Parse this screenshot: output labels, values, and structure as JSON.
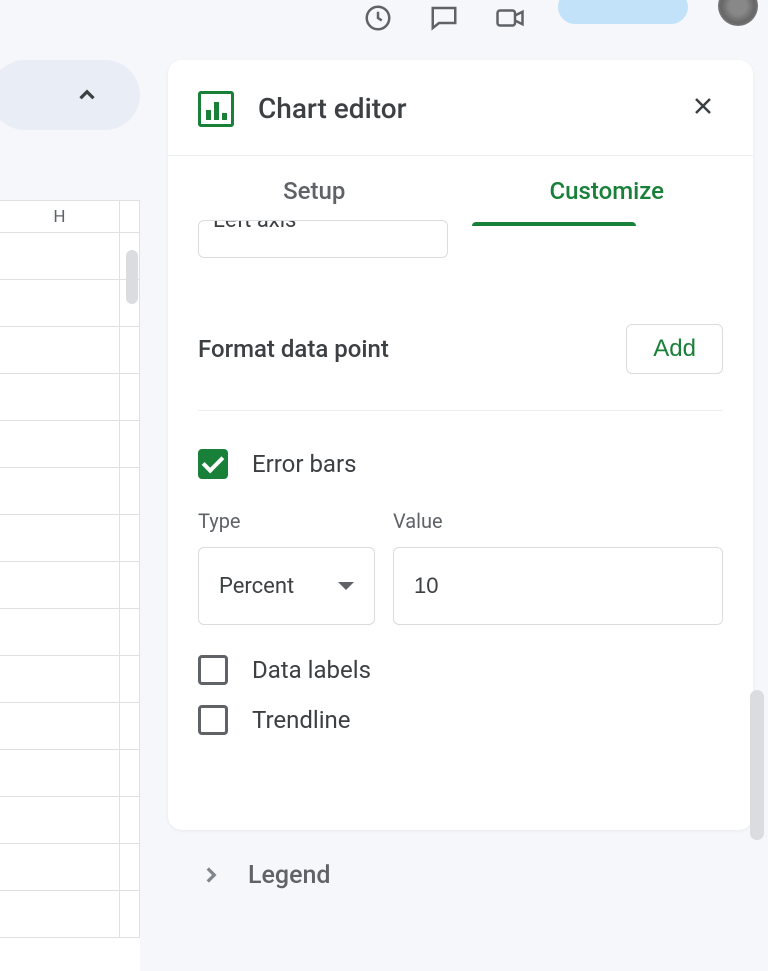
{
  "toolbar_icons": [
    "history",
    "comment",
    "video"
  ],
  "sheet": {
    "column_header": "H"
  },
  "panel": {
    "title": "Chart editor",
    "tabs": {
      "setup": "Setup",
      "customize": "Customize"
    },
    "cut_dropdown_value": "Left axis",
    "format_data_point": {
      "label": "Format data point",
      "button": "Add"
    },
    "error_bars": {
      "label": "Error bars",
      "checked": true,
      "type_label": "Type",
      "type_value": "Percent",
      "value_label": "Value",
      "value_value": "10"
    },
    "data_labels": {
      "label": "Data labels",
      "checked": false
    },
    "trendline": {
      "label": "Trendline",
      "checked": false
    },
    "legend_section": "Legend"
  }
}
